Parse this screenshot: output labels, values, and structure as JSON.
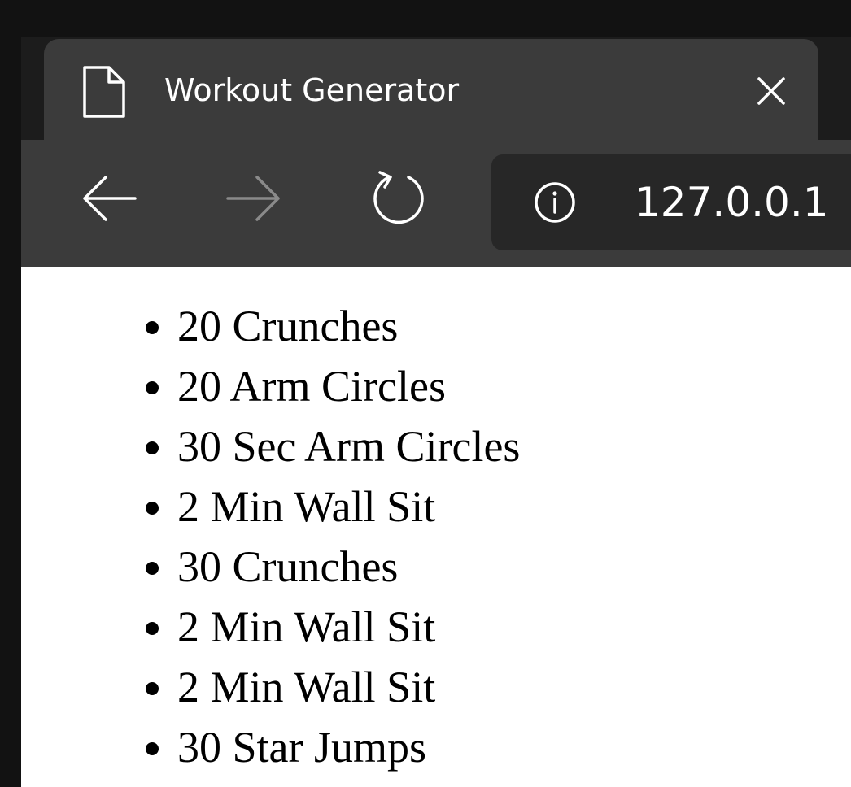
{
  "tab": {
    "title": "Workout Generator",
    "icon": "page-icon",
    "close_icon": "close-icon"
  },
  "toolbar": {
    "back_icon": "back-arrow-icon",
    "forward_icon": "forward-arrow-icon",
    "reload_icon": "reload-icon",
    "info_icon": "info-icon",
    "url": "127.0.0.1"
  },
  "workout": {
    "items": [
      "20 Crunches",
      "20 Arm Circles",
      "30 Sec Arm Circles",
      "2 Min Wall Sit",
      "30 Crunches",
      "2 Min Wall Sit",
      "2 Min Wall Sit",
      "30 Star Jumps"
    ]
  },
  "colors": {
    "frame": "#3b3b3b",
    "background": "#121212",
    "omnibox": "#272727",
    "page": "#ffffff"
  }
}
